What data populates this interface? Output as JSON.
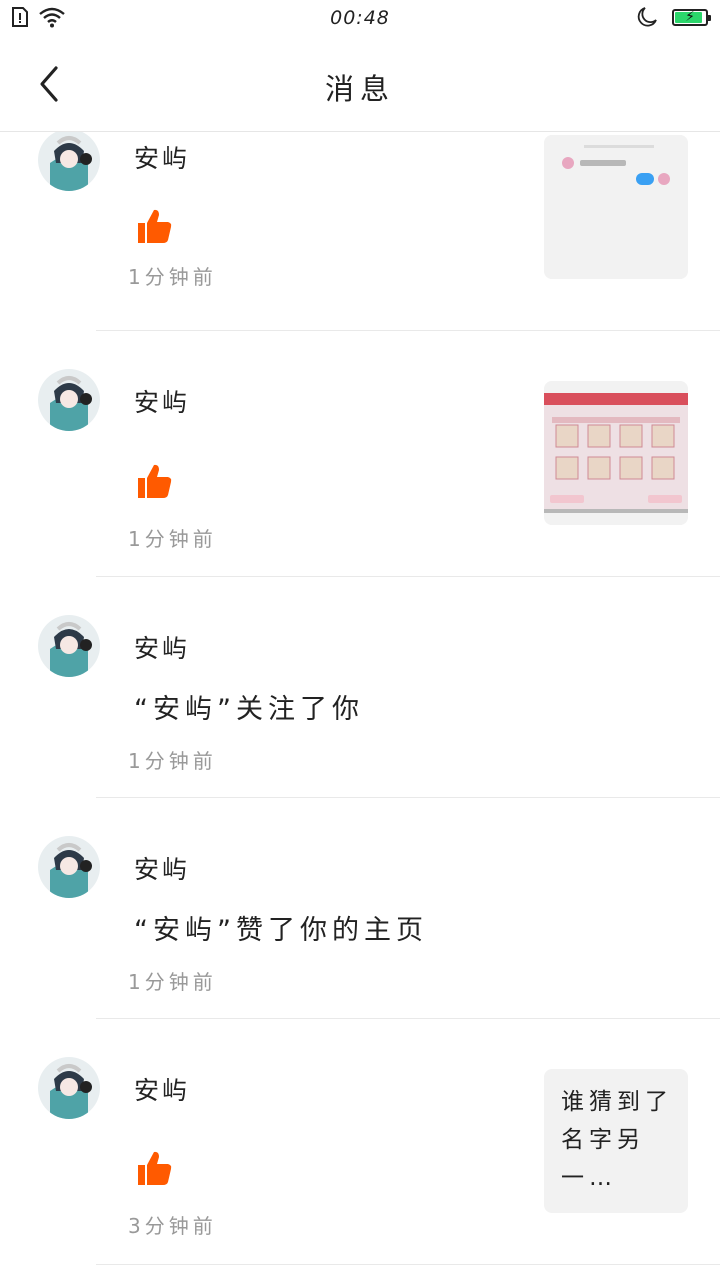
{
  "status_bar": {
    "time": "00:48",
    "icons": [
      "sim-alert-icon",
      "wifi-icon",
      "night-mode-icon",
      "battery-charging-icon"
    ],
    "battery_level": 0.9,
    "battery_color": "#2bd66b"
  },
  "header": {
    "title": "消息",
    "back_icon": "chevron-left-icon"
  },
  "colors": {
    "like_icon": "#ff5a00",
    "time_text": "#999999",
    "divider": "#e9e9e9",
    "preview_bg": "#f2f2f2"
  },
  "messages": [
    {
      "user": "安屿",
      "type": "like",
      "time": "1分钟前",
      "preview": "screenshot-chat"
    },
    {
      "user": "安屿",
      "type": "like",
      "time": "1分钟前",
      "preview": "screenshot-game"
    },
    {
      "user": "安屿",
      "type": "text",
      "text": "“安屿”关注了你",
      "time": "1分钟前"
    },
    {
      "user": "安屿",
      "type": "text",
      "text": "“安屿”赞了你的主页",
      "time": "1分钟前"
    },
    {
      "user": "安屿",
      "type": "like",
      "time": "3分钟前",
      "preview_text": "谁猜到了名字另一…"
    }
  ]
}
